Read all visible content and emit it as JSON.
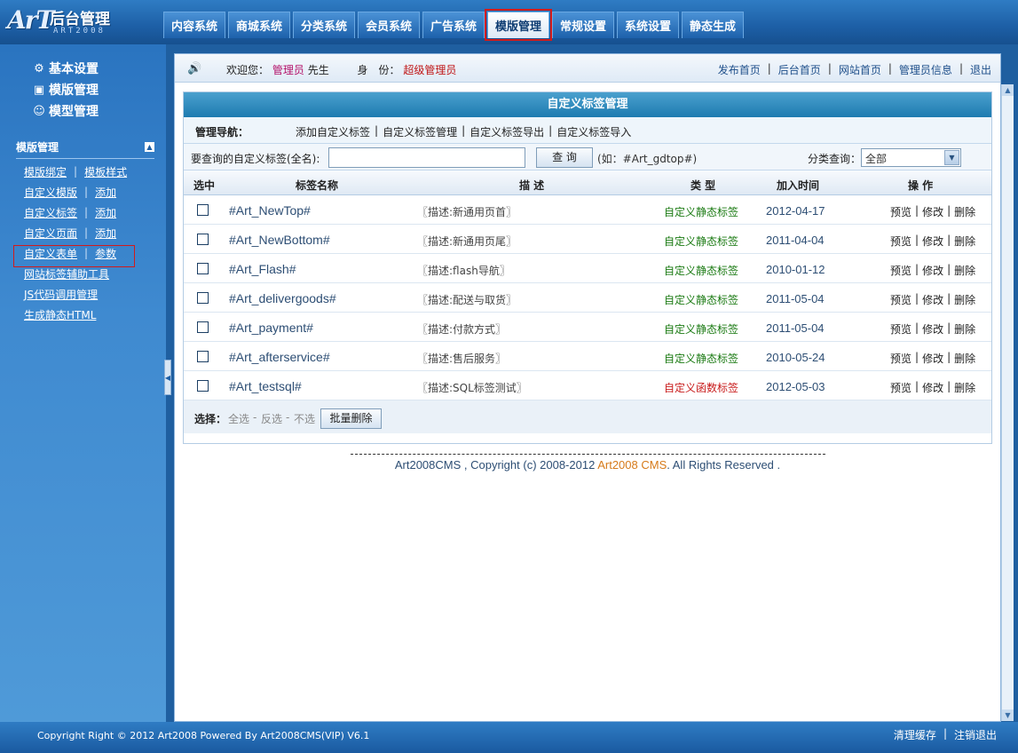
{
  "logo": {
    "mark": "ArT",
    "text": "后台管理",
    "sub": "ART2008"
  },
  "topnav": [
    "内容系统",
    "商城系统",
    "分类系统",
    "会员系统",
    "广告系统",
    "模版管理",
    "常规设置",
    "系统设置",
    "静态生成"
  ],
  "topnav_active": "模版管理",
  "sidebar": {
    "main": [
      {
        "label": "基本设置",
        "icon": "gear-icon"
      },
      {
        "label": "模版管理",
        "icon": "template-icon"
      },
      {
        "label": "模型管理",
        "icon": "user-model-icon"
      }
    ],
    "section_title": "模版管理",
    "links": [
      {
        "label": "模版绑定",
        "sep": "|",
        "extra": "模板样式"
      },
      {
        "label": "自定义模版",
        "sep": "|",
        "extra": "添加"
      },
      {
        "label": "自定义标签",
        "sep": "|",
        "extra": "添加"
      },
      {
        "label": "自定义页面",
        "sep": "|",
        "extra": "添加"
      },
      {
        "label": "自定义表单",
        "sep": "|",
        "extra": "参数"
      },
      {
        "label": "网站标签辅助工具"
      },
      {
        "label": "JS代码调用管理"
      },
      {
        "label": "生成静态HTML"
      }
    ]
  },
  "welcome": {
    "greeting": "欢迎您：",
    "role": "管理员",
    "suffix": "先生",
    "identity_label": "身　份：",
    "identity": "超级管理员"
  },
  "quicklinks": [
    "发布首页",
    "后台首页",
    "网站首页",
    "管理员信息",
    "退出"
  ],
  "panel": {
    "title": "自定义标签管理",
    "nav_label": "管理导航：",
    "nav_links": [
      "添加自定义标签",
      "自定义标签管理",
      "自定义标签导出",
      "自定义标签导入"
    ],
    "search_label": "要查询的自定义标签(全名):",
    "search_value": "",
    "search_button": "查 询",
    "search_hint": "(如：#Art_gdtop#)",
    "category_label": "分类查询：",
    "category_value": "全部"
  },
  "table": {
    "headers": [
      "选中",
      "标签名称",
      "描 述",
      "类 型",
      "加入时间",
      "操 作"
    ],
    "rows": [
      {
        "name": "#Art_NewTop#",
        "desc": "〖描述:新通用页首〗",
        "type": "自定义静态标签",
        "fn": false,
        "date": "2012-04-17"
      },
      {
        "name": "#Art_NewBottom#",
        "desc": "〖描述:新通用页尾〗",
        "type": "自定义静态标签",
        "fn": false,
        "date": "2011-04-04"
      },
      {
        "name": "#Art_Flash#",
        "desc": "〖描述:flash导航〗",
        "type": "自定义静态标签",
        "fn": false,
        "date": "2010-01-12"
      },
      {
        "name": "#Art_delivergoods#",
        "desc": "〖描述:配送与取货〗",
        "type": "自定义静态标签",
        "fn": false,
        "date": "2011-05-04"
      },
      {
        "name": "#Art_payment#",
        "desc": "〖描述:付款方式〗",
        "type": "自定义静态标签",
        "fn": false,
        "date": "2011-05-04"
      },
      {
        "name": "#Art_afterservice#",
        "desc": "〖描述:售后服务〗",
        "type": "自定义静态标签",
        "fn": false,
        "date": "2010-05-24"
      },
      {
        "name": "#Art_testsql#",
        "desc": "〖描述:SQL标签测试〗",
        "type": "自定义函数标签",
        "fn": true,
        "date": "2012-05-03"
      }
    ],
    "ops": [
      "预览",
      "修改",
      "删除"
    ],
    "footer": {
      "select_label": "选择：",
      "all": "全选",
      "invert": "反选",
      "none": "不选",
      "bulk_delete": "批量删除"
    }
  },
  "copyright": {
    "pre": "Art2008CMS , Copyright (c) 2008-2012 ",
    "brand": "Art2008 CMS",
    "post": ". All Rights Reserved ."
  },
  "bottombar": {
    "copy": "Copyright Right © 2012 Art2008 Powered By Art2008CMS(VIP) V6.1",
    "links": [
      "清理缓存",
      "注销退出"
    ]
  }
}
